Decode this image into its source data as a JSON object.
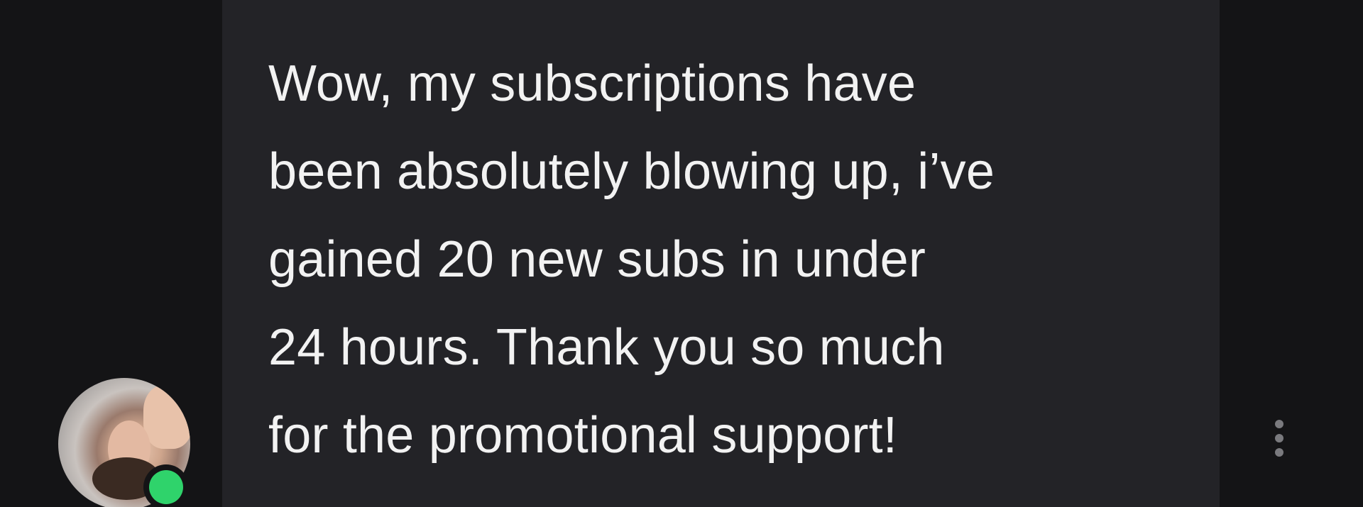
{
  "message": {
    "lines": [
      "Wow, my subscriptions have",
      "been absolutely blowing up, i’ve",
      "gained 20 new subs in under",
      "24 hours. Thank you so much",
      "for the promotional support!"
    ]
  },
  "avatar": {
    "status": "online",
    "status_color": "#2fd36b"
  },
  "menu": {
    "icon": "vertical-ellipsis-icon"
  },
  "colors": {
    "background": "#141416",
    "bubble": "#232327",
    "text": "#f2f2f2"
  }
}
